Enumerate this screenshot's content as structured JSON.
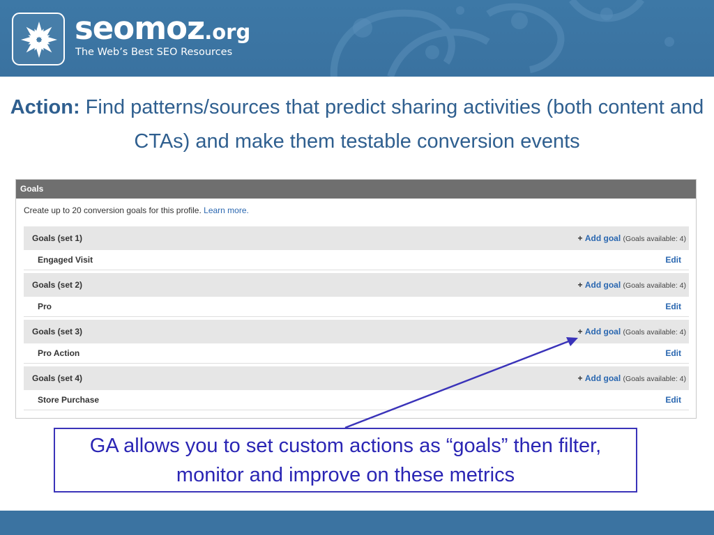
{
  "header": {
    "brand_name": "seomoz",
    "brand_tld": ".org",
    "tagline": "The Web’s Best SEO Resources",
    "logo_icon": "star-burst-icon",
    "band_color": "#3d78a6"
  },
  "headline": {
    "label": "Action:",
    "text": " Find patterns/sources that predict sharing activities (both content and CTAs) and make them testable conversion events"
  },
  "goals_panel": {
    "title": "Goals",
    "intro_text": "Create up to 20 conversion goals for this profile. ",
    "learn_more": "Learn more.",
    "sets": [
      {
        "name": "Goals (set 1)",
        "add_plus": "+",
        "add_label": "Add goal",
        "available": "(Goals available: 4)",
        "goal": "Engaged Visit",
        "edit": "Edit"
      },
      {
        "name": "Goals (set 2)",
        "add_plus": "+",
        "add_label": "Add goal",
        "available": "(Goals available: 4)",
        "goal": "Pro",
        "edit": "Edit"
      },
      {
        "name": "Goals (set 3)",
        "add_plus": "+",
        "add_label": "Add goal",
        "available": "(Goals available: 4)",
        "goal": "Pro Action",
        "edit": "Edit"
      },
      {
        "name": "Goals (set 4)",
        "add_plus": "+",
        "add_label": "Add goal",
        "available": "(Goals available: 4)",
        "goal": "Store Purchase",
        "edit": "Edit"
      }
    ]
  },
  "callout": {
    "text": "GA allows you to set custom actions as “goals” then filter, monitor and improve on these metrics",
    "color": "#2a25b4"
  },
  "footer": {
    "band_color": "#3b73a1"
  }
}
